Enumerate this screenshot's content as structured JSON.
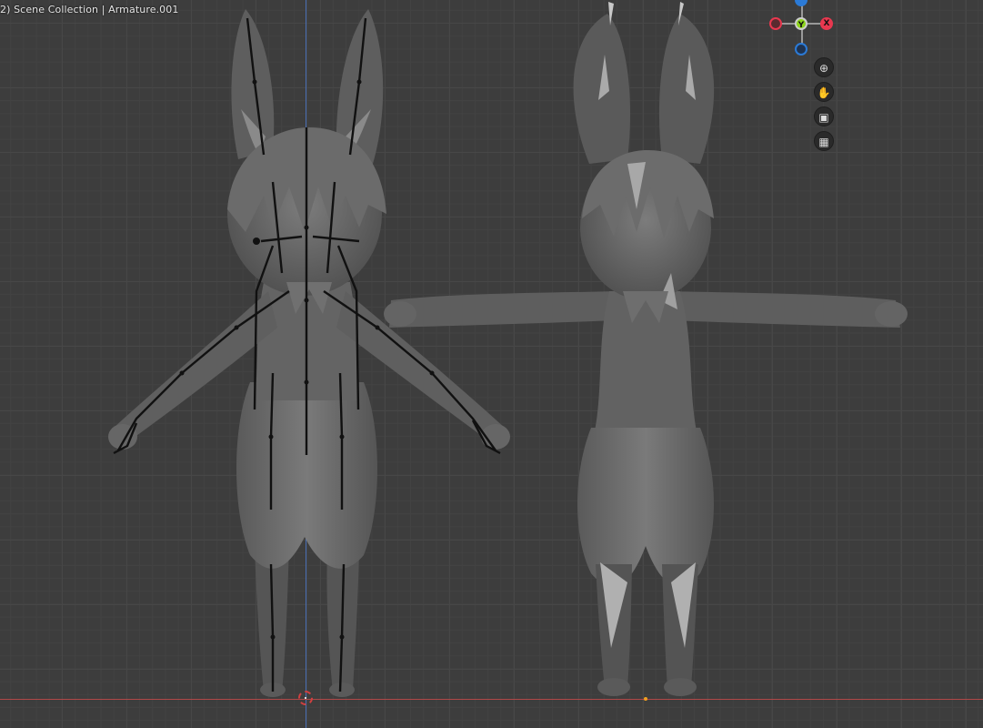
{
  "viewport": {
    "header_text": "2) Scene Collection | Armature.001"
  },
  "gizmo": {
    "x_label": "X",
    "y_label": "Y",
    "colors": {
      "x": "#e8384f",
      "y": "#8cd31b",
      "z": "#2b7ad6"
    }
  },
  "nav_tools": [
    {
      "name": "zoom-icon",
      "glyph": "⊕"
    },
    {
      "name": "pan-hand-icon",
      "glyph": "✋"
    },
    {
      "name": "camera-icon",
      "glyph": "⎔"
    },
    {
      "name": "grid-toggle-icon",
      "glyph": "▦"
    }
  ]
}
